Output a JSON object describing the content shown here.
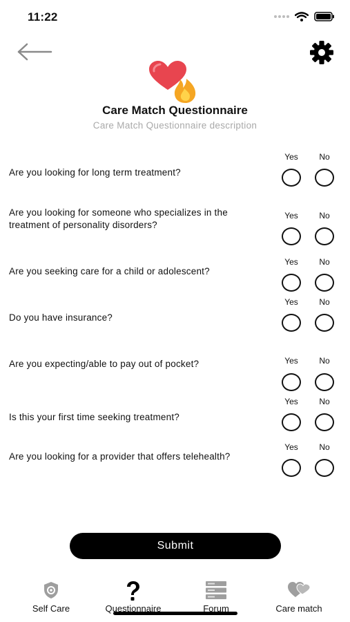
{
  "status_bar": {
    "time": "11:22"
  },
  "header": {
    "title": "Care Match Questionnaire",
    "description": "Care Match Questionnaire description"
  },
  "labels": {
    "yes": "Yes",
    "no": "No"
  },
  "questions": [
    {
      "text": "Are you looking for long term treatment?"
    },
    {
      "text": "Are you looking for someone who specializes in the treatment of personality disorders?"
    },
    {
      "text": "Are you seeking care for a child or adolescent?"
    },
    {
      "text": "Do you have insurance?"
    },
    {
      "text": "Are you expecting/able to pay out of pocket?"
    },
    {
      "text": "Is this your first time seeking treatment?"
    },
    {
      "text": "Are you looking for a provider that offers telehealth?"
    }
  ],
  "submit_label": "Submit",
  "tabs": [
    {
      "label": "Self Care",
      "icon": "shield-icon"
    },
    {
      "label": "Questionnaire",
      "icon": "question-mark-icon"
    },
    {
      "label": "Forum",
      "icon": "server-icon"
    },
    {
      "label": "Care match",
      "icon": "hearts-icon"
    }
  ],
  "colors": {
    "primary": "#000000",
    "muted_text": "#a9a9a9",
    "heart": "#e8454f",
    "flame": "#f5a623",
    "tab_icon": "#9e9e9e"
  }
}
